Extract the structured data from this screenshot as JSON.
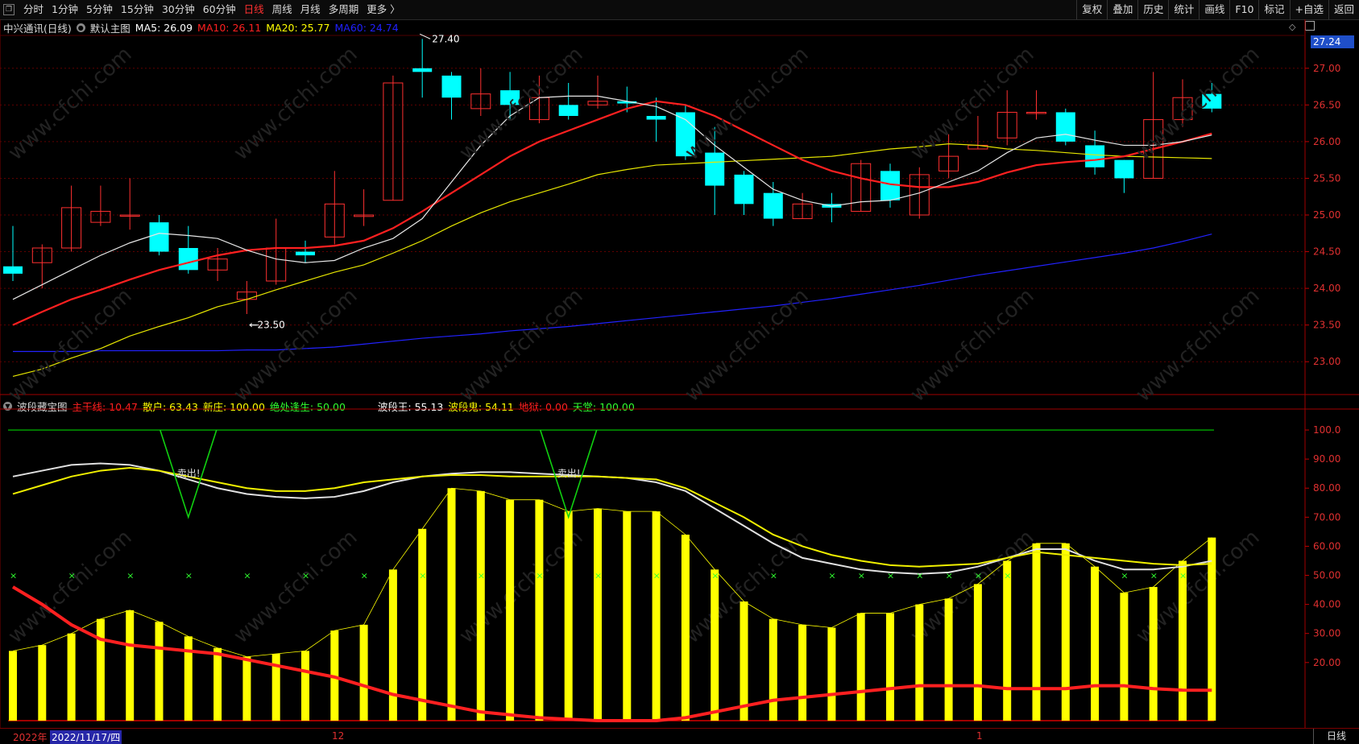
{
  "toolbar": {
    "icon": "restore-icon",
    "periods": [
      "分时",
      "1分钟",
      "5分钟",
      "15分钟",
      "30分钟",
      "60分钟",
      "日线",
      "周线",
      "月线",
      "多周期",
      "更多 〉"
    ],
    "active_period": "日线",
    "right_tools": [
      "复权",
      "叠加",
      "历史",
      "统计",
      "画线",
      "F10",
      "标记",
      "+自选",
      "返回"
    ]
  },
  "main_panel": {
    "stock": "中兴通讯(日线)",
    "template": "默认主图",
    "ma": [
      {
        "label": "MA5: 26.09",
        "color": "#ffffff"
      },
      {
        "label": "MA10: 26.11",
        "color": "#ff2020"
      },
      {
        "label": "MA20: 25.77",
        "color": "#ffff00"
      },
      {
        "label": "MA60: 24.74",
        "color": "#2020ff"
      }
    ],
    "current_price": "27.24",
    "high_marker": "27.40",
    "low_marker": "23.50",
    "price_axis": [
      "27.00",
      "26.50",
      "26.00",
      "25.50",
      "25.00",
      "24.50",
      "24.00",
      "23.50",
      "23.00"
    ]
  },
  "sub_panel": {
    "title": "波段藏宝图",
    "indicators": [
      {
        "label": "主干线: 10.47",
        "color": "#ff2020"
      },
      {
        "label": "散户: 63.43",
        "color": "#ffff00"
      },
      {
        "label": "新庄: 100.00",
        "color": "#ffff00"
      },
      {
        "label": "绝处逢生: 50.00",
        "color": "#30ff30"
      }
    ],
    "indicators2": [
      {
        "label": "波段王: 55.13",
        "color": "#ffffff"
      },
      {
        "label": "波段鬼: 54.11",
        "color": "#ffff00"
      },
      {
        "label": "地狱: 0.00",
        "color": "#ff2020"
      },
      {
        "label": "天堂: 100.00",
        "color": "#30ff30"
      }
    ],
    "sell_label": "卖出!",
    "axis": [
      "100.0",
      "90.00",
      "80.00",
      "70.00",
      "60.00",
      "50.00",
      "40.00",
      "30.00",
      "20.00"
    ]
  },
  "bottom": {
    "year": "2022年",
    "date": "2022/11/17/四",
    "month_12": "12",
    "month_1": "1",
    "tab": "日线"
  },
  "colors": {
    "up": "#ff3030",
    "down": "#00ffff",
    "ma5": "#e6e6e6",
    "ma10": "#ff2020",
    "ma20": "#e6e600",
    "ma60": "#2222ff",
    "bar": "#ffff00"
  },
  "chart_data": {
    "type": "candlestick",
    "price_range": [
      22.75,
      27.25
    ],
    "candles": [
      [
        24.3,
        24.2,
        24.85,
        24.1
      ],
      [
        24.35,
        24.55,
        24.6,
        24.0
      ],
      [
        24.55,
        25.1,
        25.4,
        24.5
      ],
      [
        24.9,
        25.05,
        25.4,
        24.85
      ],
      [
        25.0,
        25.0,
        25.5,
        24.8
      ],
      [
        24.9,
        24.5,
        25.0,
        24.45
      ],
      [
        24.55,
        24.25,
        24.85,
        24.2
      ],
      [
        24.25,
        24.4,
        24.55,
        24.1
      ],
      [
        23.85,
        23.95,
        24.1,
        23.65
      ],
      [
        24.1,
        24.55,
        24.95,
        24.05
      ],
      [
        24.5,
        24.45,
        24.65,
        24.35
      ],
      [
        24.7,
        25.15,
        25.6,
        24.6
      ],
      [
        24.98,
        25.0,
        25.35,
        24.85
      ],
      [
        25.2,
        26.8,
        26.9,
        25.2
      ],
      [
        27.0,
        26.95,
        27.4,
        26.6
      ],
      [
        26.9,
        26.6,
        26.95,
        26.3
      ],
      [
        26.45,
        26.65,
        27.0,
        26.35
      ],
      [
        26.7,
        26.5,
        26.95,
        26.3
      ],
      [
        26.3,
        26.6,
        26.9,
        26.25
      ],
      [
        26.5,
        26.35,
        26.8,
        26.3
      ],
      [
        26.5,
        26.55,
        26.9,
        26.45
      ],
      [
        26.55,
        26.52,
        26.75,
        26.4
      ],
      [
        26.35,
        26.3,
        26.6,
        26.0
      ],
      [
        26.4,
        25.8,
        26.5,
        25.75
      ],
      [
        25.85,
        25.4,
        26.2,
        25.0
      ],
      [
        25.55,
        25.15,
        25.6,
        25.0
      ],
      [
        25.3,
        24.95,
        25.45,
        24.85
      ],
      [
        24.95,
        25.15,
        25.3,
        24.95
      ],
      [
        25.15,
        25.1,
        25.3,
        24.9
      ],
      [
        25.05,
        25.7,
        25.75,
        25.05
      ],
      [
        25.6,
        25.2,
        25.7,
        25.1
      ],
      [
        25.0,
        25.55,
        25.65,
        24.95
      ],
      [
        25.6,
        25.8,
        26.1,
        25.5
      ],
      [
        25.9,
        25.95,
        26.35,
        25.9
      ],
      [
        26.05,
        26.4,
        26.7,
        25.95
      ],
      [
        26.4,
        26.4,
        26.7,
        26.3
      ],
      [
        26.4,
        26.0,
        26.45,
        25.95
      ],
      [
        25.95,
        25.65,
        26.15,
        25.55
      ],
      [
        25.75,
        25.5,
        25.75,
        25.3
      ],
      [
        25.5,
        26.3,
        26.95,
        25.5
      ],
      [
        26.3,
        26.6,
        26.85,
        26.2
      ],
      [
        26.65,
        26.45,
        26.8,
        26.4
      ]
    ],
    "ma5": [
      23.85,
      24.05,
      24.25,
      24.45,
      24.62,
      24.75,
      24.72,
      24.68,
      24.52,
      24.4,
      24.35,
      24.38,
      24.55,
      24.68,
      24.95,
      25.45,
      25.95,
      26.35,
      26.6,
      26.62,
      26.62,
      26.55,
      26.48,
      26.3,
      25.95,
      25.65,
      25.35,
      25.2,
      25.12,
      25.18,
      25.2,
      25.3,
      25.45,
      25.6,
      25.85,
      26.05,
      26.1,
      26.02,
      25.95,
      25.95,
      26.0,
      26.09
    ],
    "ma10": [
      23.5,
      23.68,
      23.85,
      23.98,
      24.12,
      24.25,
      24.35,
      24.45,
      24.52,
      24.55,
      24.55,
      24.58,
      24.65,
      24.82,
      25.05,
      25.3,
      25.55,
      25.8,
      26.0,
      26.15,
      26.3,
      26.45,
      26.55,
      26.5,
      26.35,
      26.15,
      25.95,
      25.75,
      25.6,
      25.5,
      25.42,
      25.38,
      25.38,
      25.45,
      25.58,
      25.68,
      25.72,
      25.75,
      25.8,
      25.9,
      26.0,
      26.11
    ],
    "ma20": [
      22.8,
      22.9,
      23.05,
      23.18,
      23.35,
      23.48,
      23.6,
      23.75,
      23.85,
      23.98,
      24.1,
      24.22,
      24.32,
      24.48,
      24.65,
      24.85,
      25.03,
      25.18,
      25.3,
      25.42,
      25.55,
      25.62,
      25.68,
      25.7,
      25.72,
      25.74,
      25.76,
      25.78,
      25.8,
      25.85,
      25.9,
      25.93,
      25.97,
      25.95,
      25.9,
      25.88,
      25.85,
      25.82,
      25.8,
      25.79,
      25.78,
      25.77
    ],
    "ma60": [
      23.14,
      23.14,
      23.14,
      23.15,
      23.15,
      23.15,
      23.15,
      23.15,
      23.16,
      23.16,
      23.18,
      23.2,
      23.24,
      23.28,
      23.32,
      23.35,
      23.38,
      23.42,
      23.45,
      23.48,
      23.52,
      23.56,
      23.6,
      23.64,
      23.68,
      23.72,
      23.76,
      23.81,
      23.86,
      23.92,
      23.98,
      24.04,
      24.11,
      24.18,
      24.24,
      24.3,
      24.36,
      24.42,
      24.48,
      24.55,
      24.64,
      24.74
    ],
    "bars": [
      24,
      26,
      30,
      35,
      38,
      34,
      29,
      25,
      22,
      23,
      24,
      31,
      33,
      52,
      66,
      80,
      79,
      76,
      76,
      72,
      73,
      72,
      72,
      64,
      52,
      41,
      35,
      33,
      32,
      37,
      37,
      40,
      42,
      47,
      55,
      61,
      61,
      53,
      44,
      46,
      55,
      63
    ],
    "main_line": [
      46,
      40,
      33,
      28,
      26,
      25,
      24,
      23,
      21,
      19,
      17,
      15,
      12,
      9,
      7,
      5,
      3,
      2,
      1,
      0.5,
      0,
      0,
      0,
      1,
      3,
      5,
      7,
      8,
      9,
      10,
      11,
      12,
      12,
      12,
      11,
      11,
      11,
      12,
      12,
      11,
      10.5,
      10.47
    ],
    "wave_king": [
      84,
      86,
      88,
      88.5,
      88,
      86,
      83,
      80,
      78,
      77,
      76.5,
      77,
      79,
      82,
      84,
      85,
      85.5,
      85.5,
      85,
      84.5,
      84,
      83.5,
      82,
      79,
      73,
      67,
      61,
      56,
      54,
      52,
      51,
      50.5,
      51,
      53,
      56,
      59,
      59,
      55,
      52,
      52,
      53,
      55
    ],
    "wave_ghost": [
      78,
      81,
      84,
      86,
      87,
      86,
      84,
      82,
      80,
      79,
      79,
      80,
      82,
      83,
      84,
      84.5,
      84.5,
      84,
      84,
      84,
      84,
      83.5,
      83,
      80,
      75,
      70,
      64,
      60,
      57,
      55,
      53.5,
      53,
      53.5,
      54,
      56,
      58,
      57,
      56,
      55,
      54,
      53.5,
      54
    ],
    "sell_signals": [
      6,
      19
    ],
    "cross_indices": [
      0,
      2,
      4,
      6,
      8,
      10,
      12,
      14,
      16,
      18,
      20,
      22,
      24,
      26,
      28,
      29,
      30,
      31,
      32,
      33,
      34,
      38,
      39,
      40
    ]
  }
}
